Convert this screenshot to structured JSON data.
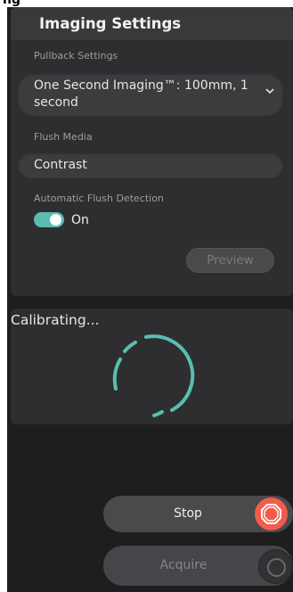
{
  "colors": {
    "background": "#1e1e1f",
    "panel": "#2e2e30",
    "accent_teal": "#5bbdb2",
    "stop_red": "#f25c4c"
  },
  "top_strip": {
    "text": "ng"
  },
  "settings": {
    "title": "Imaging Settings",
    "pullback": {
      "label": "Pullback Settings",
      "value_line1": "One Second Imaging™: 100mm, 1",
      "value_line2": "second",
      "icon": "chevron-down-icon"
    },
    "flush": {
      "label": "Flush Media",
      "value": "Contrast"
    },
    "auto_flush": {
      "label": "Automatic Flush Detection",
      "state_label": "On",
      "enabled": true
    },
    "preview_label": "Preview"
  },
  "calibration": {
    "status_text": "Calibrating...",
    "icon": "loading-spinner-icon"
  },
  "actions": {
    "stop_label": "Stop",
    "stop_icon": "stop-octagon-icon",
    "acquire_label": "Acquire",
    "acquire_icon": "record-ring-icon"
  }
}
